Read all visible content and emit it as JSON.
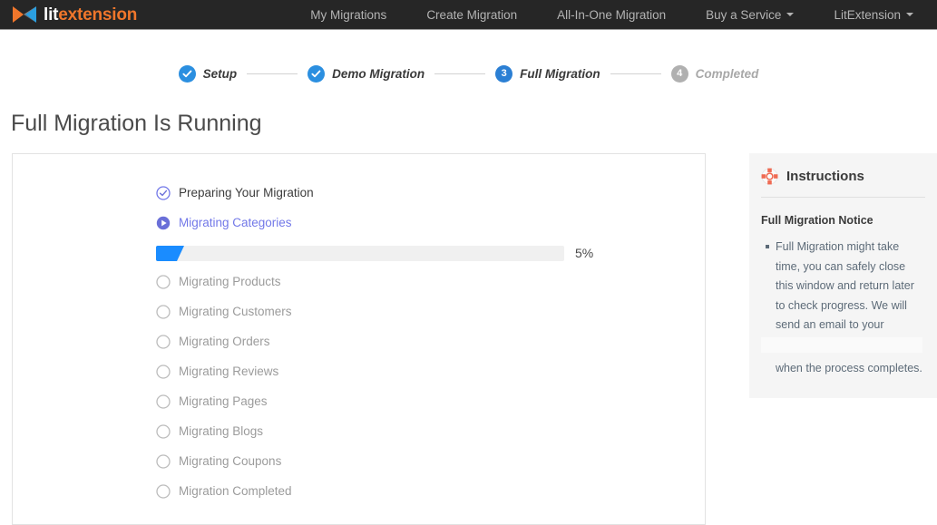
{
  "brand": {
    "name_light": "lit",
    "name_accent": "extension",
    "logo_icon": "litextension-logo-icon"
  },
  "nav": {
    "items": [
      {
        "label": "My Migrations",
        "has_caret": false
      },
      {
        "label": "Create Migration",
        "has_caret": false
      },
      {
        "label": "All-In-One Migration",
        "has_caret": false
      },
      {
        "label": "Buy a Service",
        "has_caret": true
      },
      {
        "label": "LitExtension",
        "has_caret": true
      }
    ]
  },
  "stepper": {
    "steps": [
      {
        "label": "Setup",
        "state": "done",
        "badge": "check"
      },
      {
        "label": "Demo Migration",
        "state": "done",
        "badge": "check"
      },
      {
        "label": "Full Migration",
        "state": "active",
        "badge": "3"
      },
      {
        "label": "Completed",
        "state": "todo",
        "badge": "4"
      }
    ]
  },
  "page": {
    "title": "Full Migration Is Running"
  },
  "progress": {
    "percent_label": "5%",
    "percent_value": 5,
    "items": [
      {
        "label": "Preparing Your Migration",
        "state": "done",
        "icon": "check-circle-outline-icon"
      },
      {
        "label": "Migrating Categories",
        "state": "active",
        "icon": "play-circle-icon"
      },
      {
        "label": "Migrating Products",
        "state": "todo",
        "icon": "empty-circle-icon"
      },
      {
        "label": "Migrating Customers",
        "state": "todo",
        "icon": "empty-circle-icon"
      },
      {
        "label": "Migrating Orders",
        "state": "todo",
        "icon": "empty-circle-icon"
      },
      {
        "label": "Migrating Reviews",
        "state": "todo",
        "icon": "empty-circle-icon"
      },
      {
        "label": "Migrating Pages",
        "state": "todo",
        "icon": "empty-circle-icon"
      },
      {
        "label": "Migrating Blogs",
        "state": "todo",
        "icon": "empty-circle-icon"
      },
      {
        "label": "Migrating Coupons",
        "state": "todo",
        "icon": "empty-circle-icon"
      },
      {
        "label": "Migration Completed",
        "state": "todo",
        "icon": "empty-circle-icon"
      }
    ]
  },
  "instructions": {
    "icon": "lifebuoy-icon",
    "title": "Instructions",
    "subtitle": "Full Migration Notice",
    "bullet": "Full Migration might take time, you can safely close this window and return later to check progress. We will send an email to your",
    "tail": "when the process completes."
  },
  "colors": {
    "navbar_bg": "#262626",
    "brand_accent": "#f0762b",
    "step_blue": "#2b8fe0",
    "step_gray": "#b0b0b0",
    "active_purple": "#7278e8",
    "progress_blue": "#1a8cff",
    "panel_bg": "#f5f5f5"
  }
}
